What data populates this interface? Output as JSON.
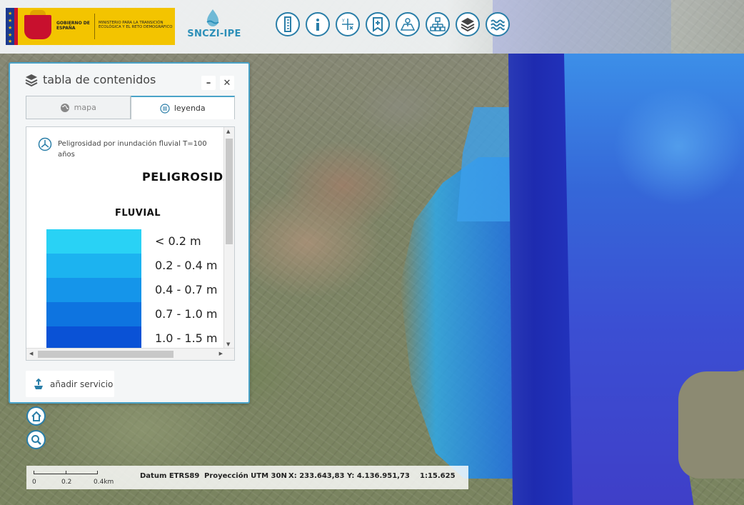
{
  "header": {
    "gov_name": "GOBIERNO DE ESPAÑA",
    "ministry": "MINISTERIO PARA LA TRANSICIÓN ECOLÓGICA Y EL RETO DEMOGRÁFICO",
    "app_name": "SNCZI-IPE"
  },
  "toolbar": {
    "tools": [
      "ruler-icon",
      "info-icon",
      "coordinates-icon",
      "bookmark-icon",
      "map-area-icon",
      "tree-icon",
      "layers-icon",
      "water-waves-icon"
    ]
  },
  "toc": {
    "title": "tabla de contenidos",
    "minimize": "–",
    "close": "✕",
    "tabs": [
      {
        "label": "mapa",
        "active": false
      },
      {
        "label": "leyenda",
        "active": true
      }
    ],
    "layer_name": "Peligrosidad por inundación fluvial T=100 años",
    "legend_heading_1": "PELIGROSIDA",
    "legend_heading_2": "FLUVIAL",
    "legend_items": [
      {
        "label": "< 0.2 m",
        "color": "#29d2f5"
      },
      {
        "label": "0.2 - 0.4 m",
        "color": "#1cb3f0"
      },
      {
        "label": "0.4 - 0.7 m",
        "color": "#1595ea"
      },
      {
        "label": "0.7 - 1.0 m",
        "color": "#0e74e0"
      },
      {
        "label": "1.0 - 1.5 m",
        "color": "#0a52d6"
      }
    ],
    "add_service": "añadir servicio"
  },
  "status": {
    "scale_labels": [
      "0",
      "0.2",
      "0.4km"
    ],
    "datum": "Datum ETRS89",
    "projection": "Proyección UTM 30N",
    "x": "X: 233.643,83",
    "y": "Y: 4.136.951,73",
    "scale": "1:15.625"
  },
  "colors": {
    "accent": "#2a7ea8",
    "panel_border": "#4aa3c8",
    "gov_yellow": "#f3c400"
  }
}
